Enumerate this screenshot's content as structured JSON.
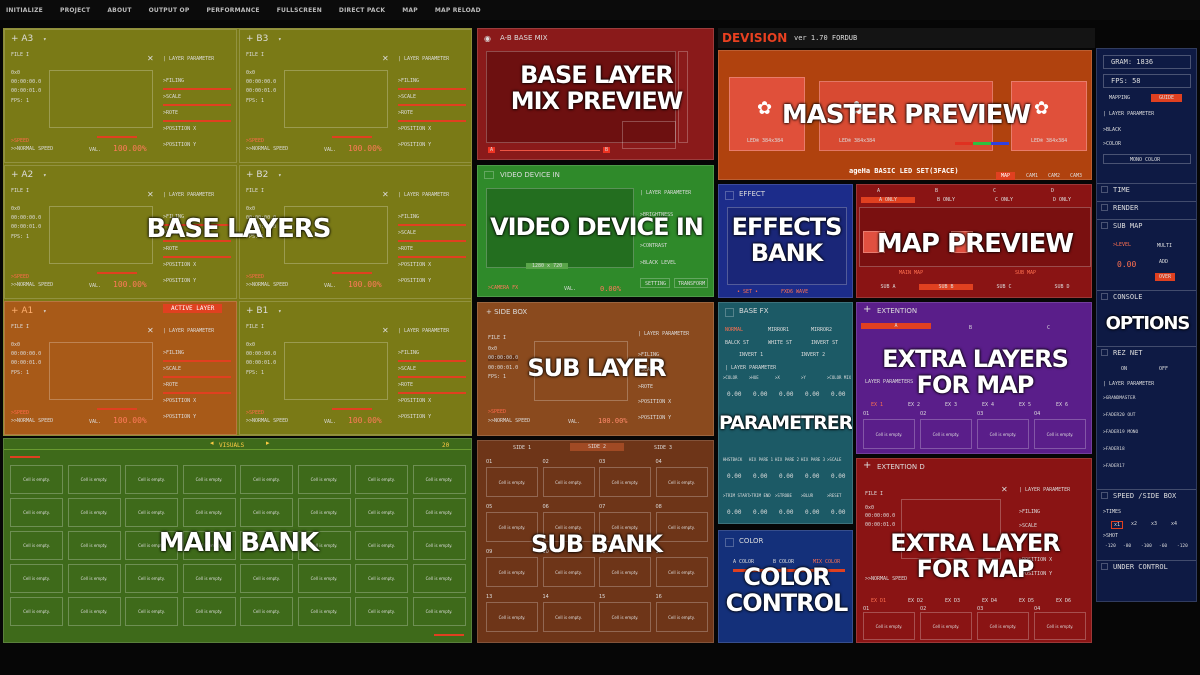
{
  "menu": [
    "INITIALIZE",
    "PROJECT",
    "ABOUT",
    "OUTPUT OP",
    "PERFORMANCE",
    "FULLSCREEN",
    "DIRECT PACK",
    "MAP",
    "MAP RELOAD"
  ],
  "layers": [
    {
      "id": "A3",
      "label": "+ A3"
    },
    {
      "id": "B3",
      "label": "+ B3"
    },
    {
      "id": "A2",
      "label": "+ A2"
    },
    {
      "id": "B2",
      "label": "+ B2"
    },
    {
      "id": "A1",
      "label": "+ A1"
    },
    {
      "id": "B1",
      "label": "+ B1"
    }
  ],
  "layer_common": {
    "file": "FILE I",
    "size": "0x0",
    "time1": "00:00:00.0",
    "time2": "00:00:01.0",
    "fps": "FPS: 1",
    "param_title": "| LAYER PARAMETER",
    "filing": ">FILING",
    "scale": ">SCALE",
    "rote": ">ROTE",
    "posx": ">POSITION X",
    "posy": ">POSITION Y",
    "speed": ">SPEED",
    "normal_speed": ">>NORMAL SPEED",
    "val": "VAL.",
    "val_value": "100.00%"
  },
  "active_layer_badge": "ACTIVE LAYER",
  "overlays": {
    "base_layers": "BASE LAYERS",
    "main_bank": "MAIN BANK",
    "base_mix": [
      "BASE LAYER",
      "MIX PREVIEW"
    ],
    "video_in": "VIDEO DEVICE IN",
    "sub_layer": "SUB LAYER",
    "sub_bank": "SUB BANK",
    "master": "MASTER PREVIEW",
    "effects": [
      "EFFECTS",
      "BANK"
    ],
    "map_preview": "MAP PREVIEW",
    "params": "PARAMETRERS",
    "extra_layers": [
      "EXTRA LAYERS",
      "FOR MAP"
    ],
    "color": [
      "COLOR",
      "CONTROL"
    ],
    "extra_layer": [
      "EXTRA LAYER",
      "FOR MAP"
    ],
    "options": "OPTIONS"
  },
  "visuals": {
    "title": "VISUALS",
    "count": "20",
    "cell_text": "Cell is empty."
  },
  "base_mix": {
    "title": "A-B BASE MIX",
    "a": "A",
    "b": "B"
  },
  "video_in": {
    "title": "VIDEO DEVICE IN",
    "res": "1280 x 720",
    "source": ">CAMERA FX",
    "val": "VAL.",
    "val_value": "0.00%",
    "brightness": ">BRIGHTNESS",
    "contrast": ">CONTRAST",
    "black": ">BLACK LEVEL",
    "setting": "SETTING",
    "transform": "TRANSFORM"
  },
  "side_box": {
    "title": "+ SIDE BOX"
  },
  "sub_bank": {
    "tabs": [
      "SIDE 1",
      "SIDE 2",
      "SIDE 3"
    ],
    "cells": [
      "01",
      "02",
      "03",
      "04",
      "05",
      "06",
      "07",
      "08",
      "09",
      "10",
      "11",
      "12",
      "13",
      "14",
      "15",
      "16"
    ]
  },
  "header": {
    "brand": "DEVISION",
    "version": "ver 1.70 FORDUB"
  },
  "master": {
    "caption": "ageHa BASIC LED SET(3FACE)",
    "tabs": [
      "MAP",
      "CAM1",
      "CAM2",
      "CAM3"
    ],
    "led": "LED® 384x384"
  },
  "effects": {
    "title": "EFFECT",
    "set": "• SET •",
    "wave": "FXD6 WAVE"
  },
  "map_preview": {
    "cols": [
      "A",
      "B",
      "C",
      "D"
    ],
    "only": [
      "A ONLY",
      "B ONLY",
      "C ONLY",
      "D ONLY"
    ],
    "main_map": "MAIN MAP",
    "sub_map": "SUB MAP",
    "subs": [
      "SUB A",
      "SUB B",
      "SUB C",
      "SUB D"
    ]
  },
  "base_fx": {
    "title": "BASE FX",
    "row1": [
      "NORMAL",
      "MIRROR1",
      "MIRROR2"
    ],
    "row2": [
      "BALCK ST",
      "WHITE ST",
      "INVERT ST"
    ],
    "row3": [
      "INVERT 1",
      "INVERT 2"
    ],
    "param": "| LAYER PARAMETER",
    "cols": [
      ">COLOR",
      ">HUE",
      ">X",
      ">Y",
      ">COLOR MIX"
    ],
    "vals": [
      "0.00",
      "0.00",
      "0.00",
      "0.00",
      "0.00"
    ],
    "cols2": [
      "HHSTBACK",
      "HIX PARE 1",
      "HIX PARE 2",
      "HIX PARE 3",
      ">SCALE"
    ],
    "vals2": [
      "0.00",
      "0.00",
      "0.00",
      "0.00",
      "0.00"
    ],
    "cols3": [
      ">TRIM START",
      ">TRIM END",
      ">STROBE",
      ">BLUR",
      ">RESET"
    ],
    "vals3": [
      "0.00",
      "0.00",
      "0.00",
      "0.00",
      "0.00"
    ]
  },
  "color": {
    "title": "COLOR",
    "a": "A COLOR",
    "b": "B COLOR",
    "mix": "MIX COLOR"
  },
  "extention": {
    "title": "EXTENTION",
    "cols": [
      "A",
      "B",
      "C"
    ],
    "ex": [
      "EX 1",
      "EX 2",
      "EX 3",
      "EX 4",
      "EX 5",
      "EX 6"
    ],
    "cells": [
      "01",
      "02",
      "03",
      "04"
    ],
    "layer_params": "LAYER PARAMETERS"
  },
  "extention_d": {
    "title": "EXTENTION D",
    "ex": [
      "EX D1",
      "EX D2",
      "EX D3",
      "EX D4",
      "EX D5",
      "EX D6"
    ],
    "cells": [
      "01",
      "02",
      "03",
      "04"
    ]
  },
  "right": {
    "gram": "GRAM: 1836",
    "fps": "FPS: 58",
    "mapping": "MAPPING",
    "guide": "GUIDE",
    "param": "| LAYER PARAMETER",
    "black": ">BLACK",
    "color": ">COLOR",
    "mono": "MONO COLOR",
    "time": "TIME",
    "render": "RENDER",
    "submap": "SUB MAP",
    "level": ">LEVEL",
    "level_val": "0.00",
    "multi": "MULTI",
    "add": "ADD",
    "over": "OVER",
    "console": "CONSOLE",
    "reznet": "REZ NET",
    "on": "ON",
    "off": "OFF",
    "rez_items": [
      ">GRANDMASTER",
      ">FADER20 OUT",
      ">FADER19 MONO",
      ">FADER18",
      ">FADER17"
    ],
    "speed": "SPEED /SIDE BOX",
    "times": ">TIMES",
    "mult": [
      "x1",
      "x2",
      "x3",
      "x4"
    ],
    "shot": ">SHOT",
    "shot_vals": [
      "-120",
      "-80",
      "-100",
      "-60",
      "-120"
    ],
    "under": "UNDER CONTROL"
  }
}
